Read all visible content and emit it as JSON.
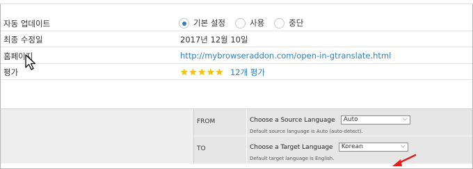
{
  "settings": [
    {
      "label": "자동 업데이트",
      "type": "radio",
      "options": [
        "기본 설정",
        "사용",
        "중단"
      ],
      "selected": 0
    },
    {
      "label": "최종 수정일",
      "value": "2017년 12월 10일"
    },
    {
      "label": "홈페이지",
      "value": "http://mybrowseraddon.com/open-in-gtranslate.html"
    },
    {
      "label": "평가",
      "stars": 5,
      "rating_text": "12개 평가"
    }
  ],
  "language": {
    "from": {
      "key": "FROM",
      "prompt": "Choose a Source Language",
      "selected": "Auto",
      "hint": "Default source language is Auto (auto-detect)."
    },
    "to": {
      "key": "TO",
      "prompt": "Choose a Target Language",
      "selected": "Korean",
      "hint": "Default target language is English."
    }
  },
  "colors": {
    "link": "#2a7ec2",
    "star": "#f5c400",
    "arrow": "#e0201b"
  },
  "icons": {
    "cursor": "mouse-pointer-icon",
    "annotation": "red-arrow-icon"
  }
}
